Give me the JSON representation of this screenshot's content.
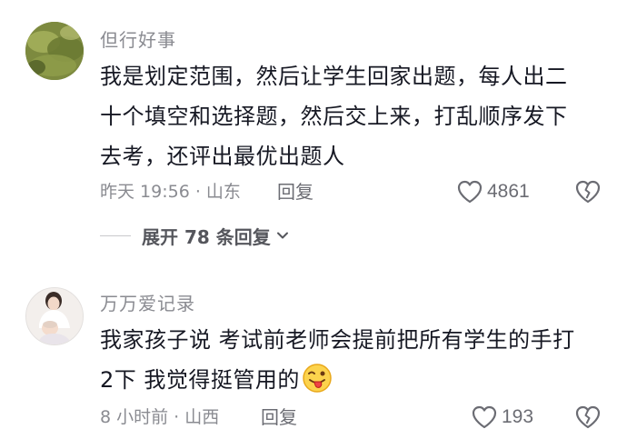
{
  "comments": [
    {
      "username": "但行好事",
      "lines": [
        "我是划定范围，然后让学生回家出题，每人出二",
        "十个填空和选择题，然后交上来，打乱顺序发下",
        "去考，还评出最优出题人"
      ],
      "time_location": "昨天 19:56 · 山东",
      "reply_label": "回复",
      "likes": "4861",
      "expand_label": "展开 78 条回复"
    },
    {
      "username": "万万爱记录",
      "lines": [
        "我家孩子说 考试前老师会提前把所有学生的手打",
        "2下 我觉得挺管用的"
      ],
      "time_location": "8 小时前 · 山西",
      "reply_label": "回复",
      "likes": "193"
    }
  ],
  "icons": {
    "like": "heart-outline-icon",
    "dislike": "broken-heart-icon",
    "expand": "chevron-down-icon",
    "emoji": "tongue-wink-emoji"
  },
  "colors": {
    "text_primary": "#161823",
    "text_secondary": "#8a8b91",
    "icon_gray": "#6b6c73"
  }
}
